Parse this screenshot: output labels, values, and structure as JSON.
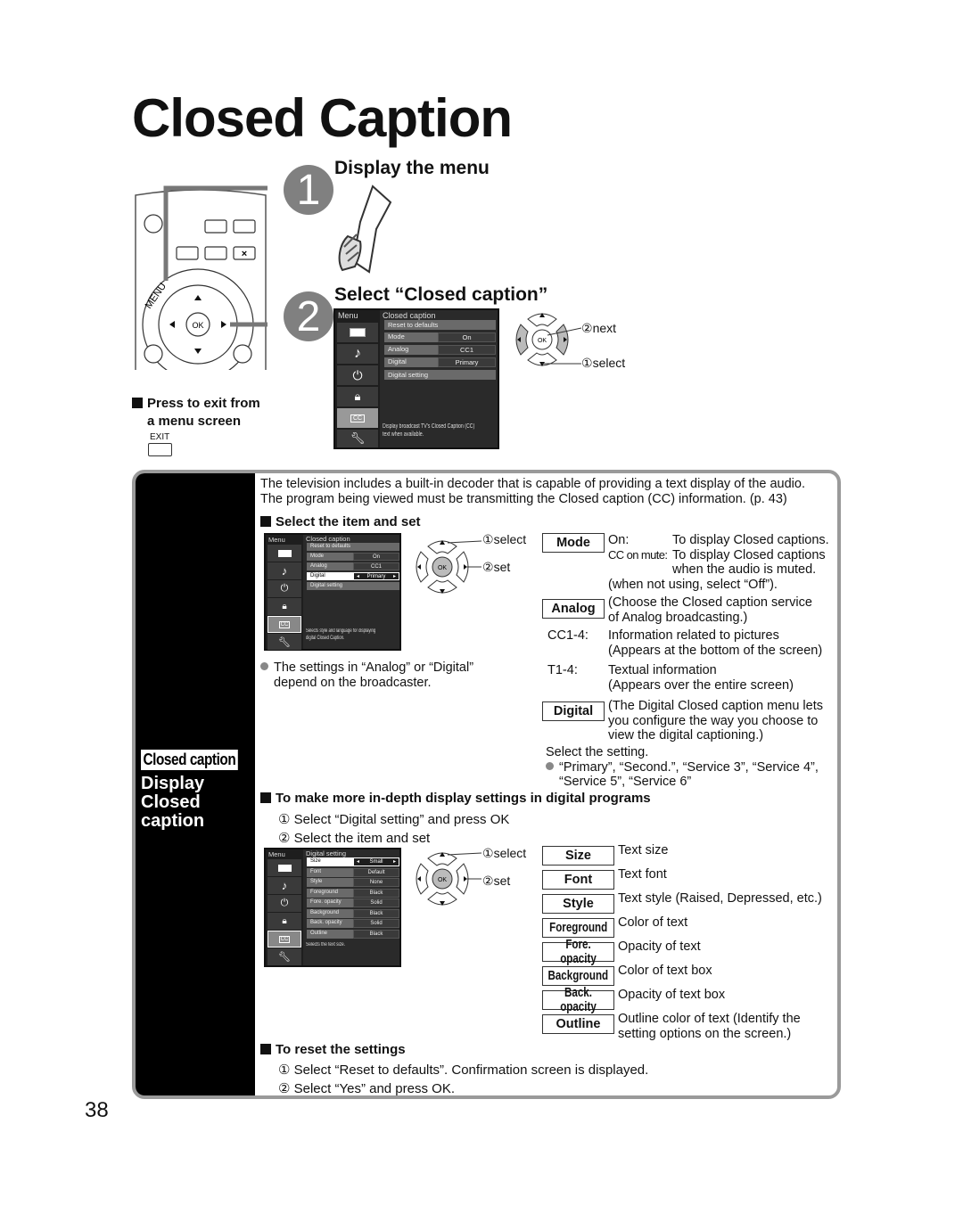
{
  "page": {
    "title": "Closed Caption",
    "page_number": "38"
  },
  "steps": [
    {
      "number": "1",
      "heading": "Display the menu"
    },
    {
      "number": "2",
      "heading": "Select “Closed caption”"
    }
  ],
  "remote": {
    "menu_label": "MENU",
    "ok_label": "OK",
    "x_label": "×"
  },
  "exit_note": {
    "line1": "Press to exit from",
    "line2": "a menu screen",
    "button_label": "EXIT"
  },
  "menu_main": {
    "side_label": "Menu",
    "title": "Closed caption",
    "rows": [
      {
        "label": "Reset to defaults",
        "value": ""
      },
      {
        "label": "Mode",
        "value": "On"
      },
      {
        "label": "Analog",
        "value": "CC1"
      },
      {
        "label": "Digital",
        "value": "Primary"
      },
      {
        "label": "Digital setting",
        "value": ""
      }
    ],
    "icons": [
      "picture-icon",
      "audio-icon",
      "timer-icon",
      "lock-icon",
      "cc-icon",
      "setup-icon"
    ],
    "cc_text": "CC",
    "description_line1": "Display broadcast TV's Closed Caption (CC)",
    "description_line2": "text when available."
  },
  "nav_step2": {
    "ok_label": "OK",
    "next_label": "next",
    "select_label": "select",
    "num_next": "②",
    "num_select": "①"
  },
  "panel": {
    "tag": "Closed caption",
    "side_title_line1": "Display",
    "side_title_line2": "Closed",
    "side_title_line3": "caption",
    "intro_line1": "The television includes a built-in decoder that is capable of providing a text display of the audio.",
    "intro_line2": "The program being viewed must be transmitting the Closed caption (CC) information. (p. 43)",
    "section1": {
      "heading": "Select the item and set",
      "menu": {
        "side_label": "Menu",
        "title": "Closed caption",
        "rows": [
          {
            "label": "Reset to defaults",
            "value": ""
          },
          {
            "label": "Mode",
            "value": "On"
          },
          {
            "label": "Analog",
            "value": "CC1"
          },
          {
            "label": "Digital",
            "value": "Primary"
          },
          {
            "label": "Digital setting",
            "value": ""
          }
        ],
        "cc_text": "CC",
        "description_line1": "Selects style and language for displaying",
        "description_line2": "digital Closed Caption."
      },
      "nav": {
        "ok_label": "OK",
        "select_label": "select",
        "set_label": "set",
        "num_select": "①",
        "num_set": "②"
      },
      "note": "The settings in “Analog” or “Digital” depend on the broadcaster.",
      "mode": {
        "key": "Mode",
        "on_label": "On:",
        "on_desc": "To display Closed captions.",
        "mute_label": "CC on mute:",
        "mute_desc1": "To display Closed captions",
        "mute_desc2": "when the audio is muted.",
        "off_note": "(when not using, select “Off”)."
      },
      "analog": {
        "key": "Analog",
        "desc1": "(Choose the Closed caption service",
        "desc2": "of Analog broadcasting.)",
        "items": [
          {
            "code": "CC1-4:",
            "line1": "Information related to pictures",
            "line2": "(Appears at the bottom of the screen)"
          },
          {
            "code": "T1-4:",
            "line1": "Textual information",
            "line2": "(Appears over the entire screen)"
          }
        ]
      },
      "digital": {
        "key": "Digital",
        "desc1": "(The Digital Closed caption menu lets",
        "desc2": "you configure the way you choose to",
        "desc3": "view the digital captioning.)",
        "select_text": "Select the setting.",
        "options_line1": "“Primary”, “Second.”, “Service 3”, “Service 4”,",
        "options_line2": "“Service 5”, “Service 6”"
      }
    },
    "section2": {
      "heading": "To make more in-depth display settings in digital programs",
      "step1": "Select “Digital setting” and press OK",
      "step2": "Select the item and set",
      "num1": "①",
      "num2": "②",
      "menu": {
        "side_label": "Menu",
        "title": "Digital setting",
        "rows": [
          {
            "label": "Size",
            "value": "Small"
          },
          {
            "label": "Font",
            "value": "Default"
          },
          {
            "label": "Style",
            "value": "None"
          },
          {
            "label": "Foreground",
            "value": "Black"
          },
          {
            "label": "Fore. opacity",
            "value": "Solid"
          },
          {
            "label": "Background",
            "value": "Black"
          },
          {
            "label": "Back. opacity",
            "value": "Solid"
          },
          {
            "label": "Outline",
            "value": "Black"
          }
        ],
        "cc_text": "CC",
        "description": "Selects the text size."
      },
      "nav": {
        "ok_label": "OK",
        "select_label": "select",
        "set_label": "set",
        "num_select": "①",
        "num_set": "②"
      },
      "settings": [
        {
          "key": "Size",
          "desc": "Text size"
        },
        {
          "key": "Font",
          "desc": "Text font"
        },
        {
          "key": "Style",
          "desc": "Text style (Raised, Depressed, etc.)"
        },
        {
          "key": "Foreground",
          "desc": "Color of text"
        },
        {
          "key": "Fore. opacity",
          "desc": "Opacity of text"
        },
        {
          "key": "Background",
          "desc": "Color of text box"
        },
        {
          "key": "Back. opacity",
          "desc": "Opacity of text box"
        },
        {
          "key": "Outline",
          "desc": "Outline color of text (Identify the",
          "desc2": "setting options on the screen.)"
        }
      ]
    },
    "section3": {
      "heading": "To reset the settings",
      "step1": "Select “Reset to defaults”. Confirmation screen is displayed.",
      "step2": "Select “Yes” and press OK.",
      "num1": "①",
      "num2": "②"
    }
  }
}
